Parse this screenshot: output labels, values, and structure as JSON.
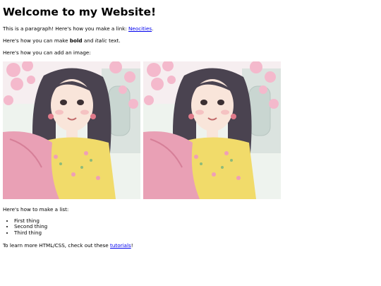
{
  "page": {
    "heading": "Welcome to my Website!",
    "para1": {
      "text": "This is a paragraph! Here's how you make a link: ",
      "link": "Neocities",
      "after": "."
    },
    "para2": {
      "before": "Here's how you can make ",
      "bold": "bold",
      "middle": " and ",
      "italic": "italic",
      "after": " text."
    },
    "para3": "Here's how you can add an image:",
    "list_intro": "Here's how to make a list:",
    "list": [
      "First thing",
      "Second thing",
      "Third thing"
    ],
    "footer": {
      "text": "To learn more HTML/CSS, check out these ",
      "link": "tutorials",
      "after": "!"
    }
  },
  "colors": {
    "link": "#0000ee",
    "scarf": "#e9a0b5",
    "dress": "#f1db6a",
    "hair": "#4a4350",
    "blossom": "#f4b9cc"
  }
}
